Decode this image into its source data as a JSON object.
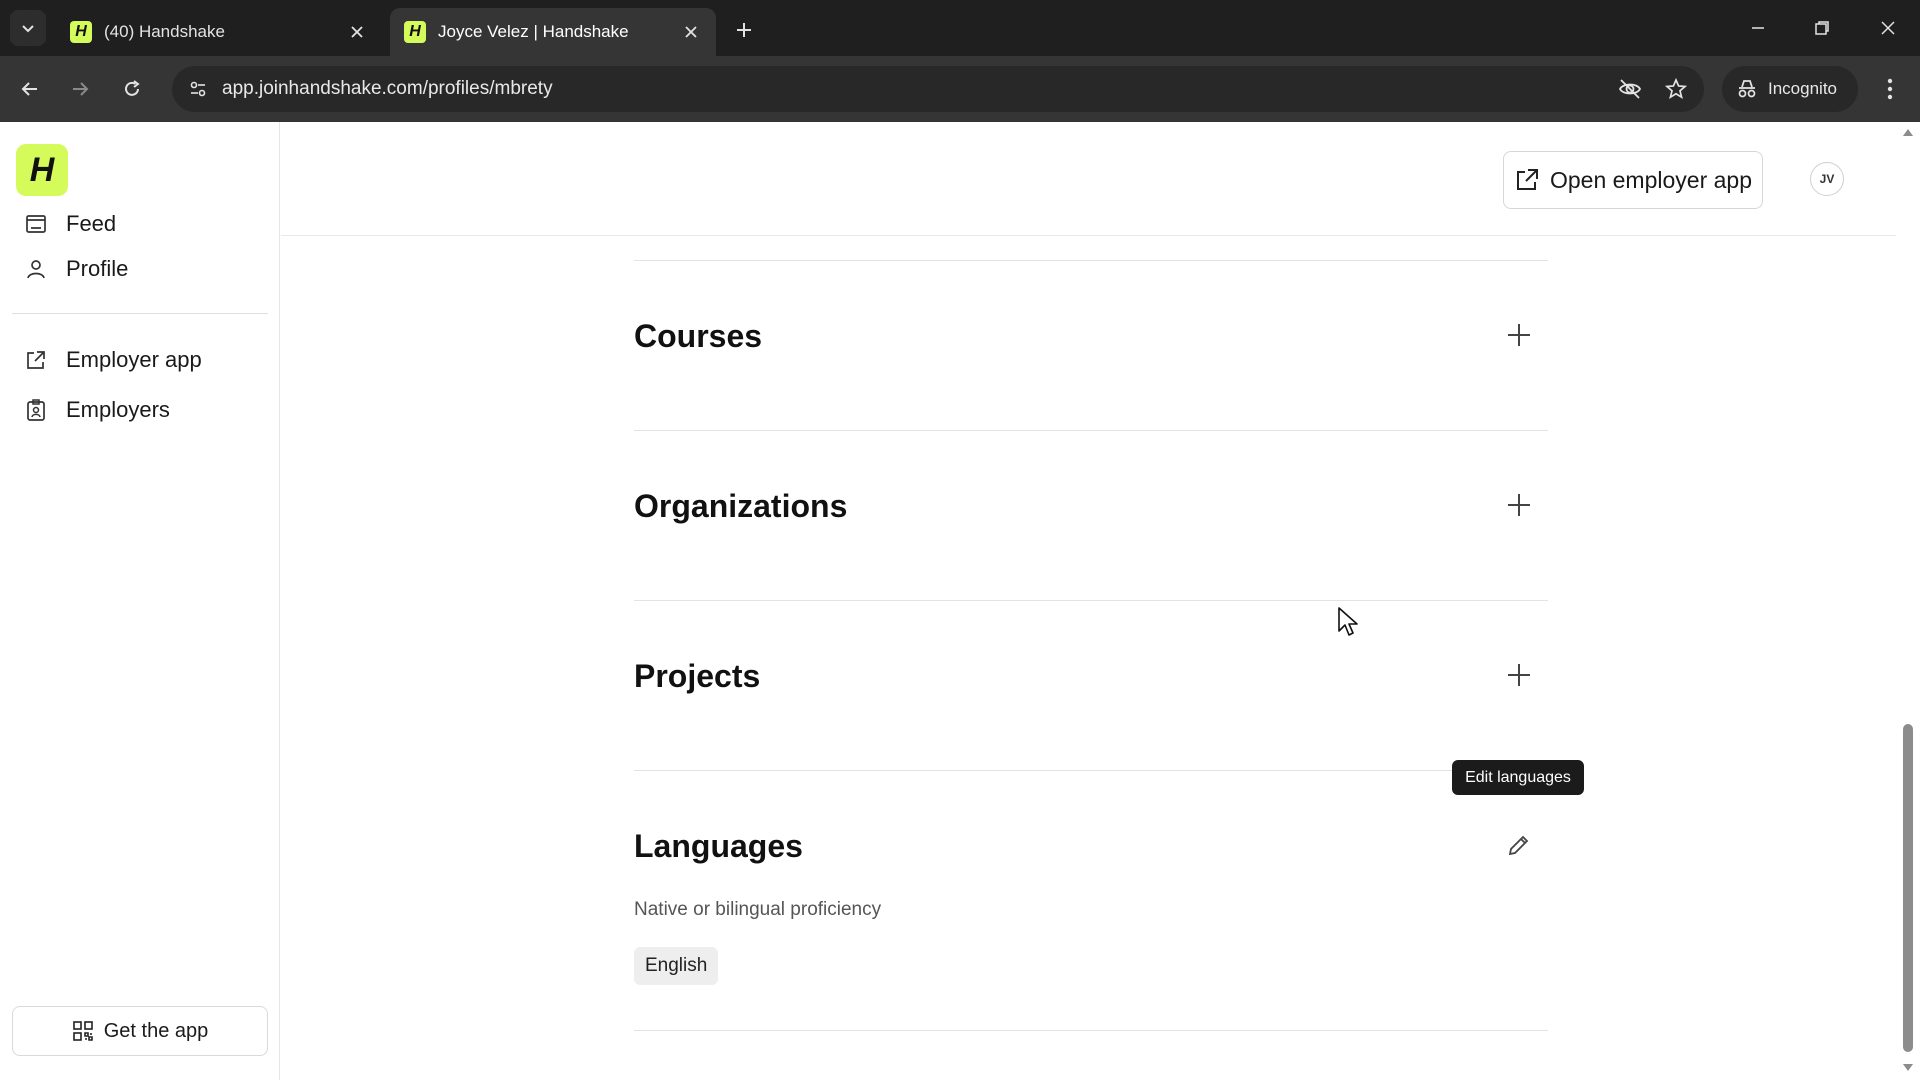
{
  "browser": {
    "tabs": [
      {
        "title": "(40) Handshake",
        "favicon": "H",
        "active": false
      },
      {
        "title": "Joyce Velez | Handshake",
        "favicon": "H",
        "active": true
      }
    ],
    "url": "app.joinhandshake.com/profiles/mbrety",
    "incognito_label": "Incognito",
    "icons": [
      "tab-search-icon",
      "close-icon",
      "new-tab-icon",
      "minimize-icon",
      "restore-icon",
      "window-close-icon",
      "back-icon",
      "forward-icon",
      "reload-icon",
      "site-info-icon",
      "eye-off-icon",
      "star-icon",
      "incognito-icon",
      "kebab-menu-icon"
    ]
  },
  "sidebar": {
    "logo": "H",
    "items": [
      {
        "label": "Feed",
        "icon": "feed-icon"
      },
      {
        "label": "Profile",
        "icon": "person-icon"
      },
      {
        "label": "Employer app",
        "icon": "external-link-icon"
      },
      {
        "label": "Employers",
        "icon": "badge-icon"
      }
    ],
    "get_app_label": "Get the app"
  },
  "header": {
    "open_employer_label": "Open employer app",
    "avatar_initials": "JV"
  },
  "sections": {
    "courses": {
      "title": "Courses",
      "action_icon": "plus-icon"
    },
    "organizations": {
      "title": "Organizations",
      "action_icon": "plus-icon"
    },
    "projects": {
      "title": "Projects",
      "action_icon": "plus-icon"
    },
    "languages": {
      "title": "Languages",
      "action_icon": "pencil-icon",
      "proficiency": "Native or bilingual proficiency",
      "languages": [
        "English"
      ]
    }
  },
  "tooltip": "Edit languages",
  "colors": {
    "brand": "#d5fb5a",
    "chrome_dark": "#1f1f1f",
    "chrome_toolbar": "#353535",
    "tooltip_bg": "#1b1b1b"
  }
}
